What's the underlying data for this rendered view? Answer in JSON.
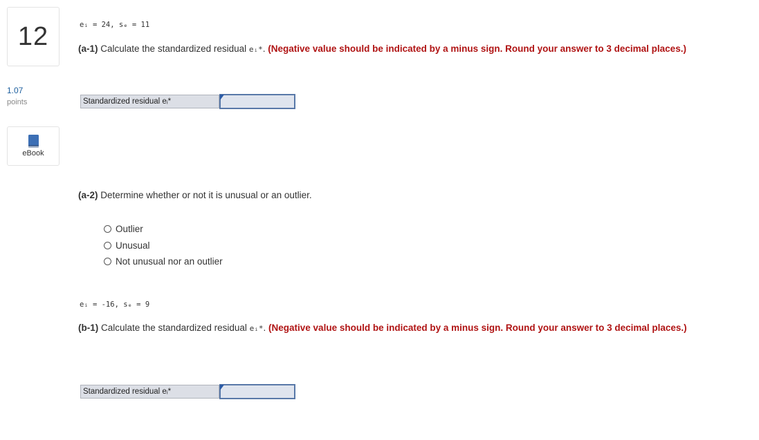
{
  "question": {
    "number": "12",
    "points_value": "1.07",
    "points_label": "points",
    "ebook_label": "eBook"
  },
  "part_a": {
    "formula": "eᵢ = 24, sₑ = 11",
    "a1_prefix": "(a-1)",
    "a1_text": " Calculate the standardized residual ",
    "a1_symbol": "eᵢ*",
    "a1_period": ". ",
    "a1_instruction": "(Negative value should be indicated by a minus sign. Round your answer to 3 decimal places.)",
    "answer_label": "Standardized residual eᵢ*",
    "answer_value": "",
    "a2_prefix": "(a-2)",
    "a2_text": " Determine whether or not it is unusual or an outlier.",
    "options": [
      "Outlier",
      "Unusual",
      "Not unusual nor an outlier"
    ]
  },
  "part_b": {
    "formula": "eᵢ = -16, sₑ = 9",
    "b1_prefix": "(b-1)",
    "b1_text": " Calculate the standardized residual ",
    "b1_symbol": "eᵢ*",
    "b1_period": ". ",
    "b1_instruction": "(Negative value should be indicated by a minus sign. Round your answer to 3 decimal places.)",
    "answer_label": "Standardized residual eᵢ*",
    "answer_value": ""
  },
  "colors": {
    "instruction_red": "#b01414",
    "points_blue": "#1d5f9e",
    "input_border": "#5878a8"
  },
  "icons": {
    "ebook": "book-icon"
  }
}
